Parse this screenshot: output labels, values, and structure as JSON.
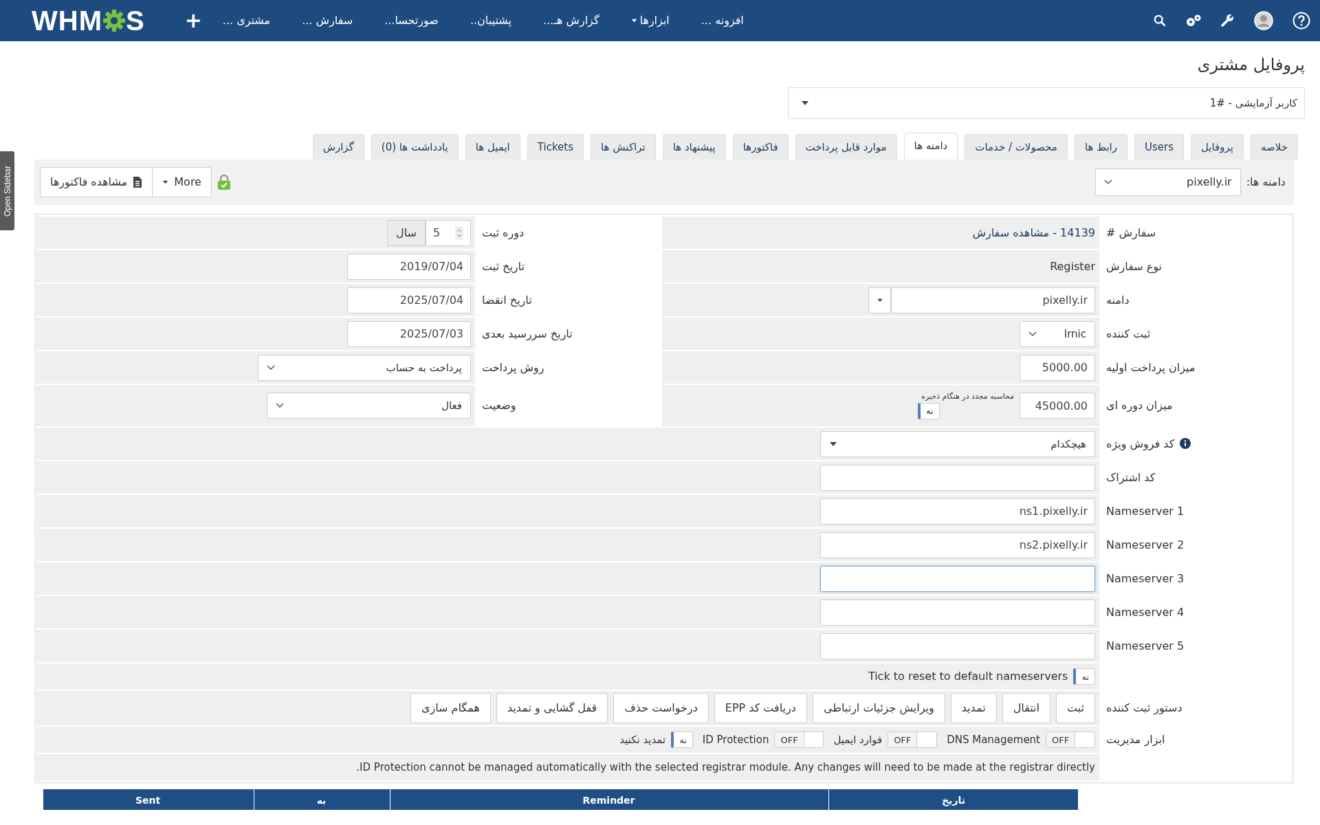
{
  "sidebar_toggle": "Open Sidebar",
  "navbar": {
    "logo": {
      "left": "WHM",
      "right": "S"
    },
    "add": "+",
    "menu": [
      {
        "label": "افزونه ...",
        "dropdown": false
      },
      {
        "label": "ابزارها",
        "dropdown": true
      },
      {
        "label": "گزارش هـ...",
        "dropdown": false
      },
      {
        "label": "پشتیبان..",
        "dropdown": false
      },
      {
        "label": "صورتحسا...",
        "dropdown": false
      },
      {
        "label": "سفارش ...",
        "dropdown": false
      },
      {
        "label": "مشتری ...",
        "dropdown": false
      }
    ]
  },
  "page_title": "پروفایل مشتری",
  "client_select": "کاربر آزمایشی - #1",
  "tabs": [
    {
      "label": "خلاصه",
      "selected": false
    },
    {
      "label": "پروفایل",
      "selected": false
    },
    {
      "label": "Users",
      "selected": false
    },
    {
      "label": "رابط ها",
      "selected": false
    },
    {
      "label": "محصولات / خدمات",
      "selected": false
    },
    {
      "label": "دامنه ها",
      "selected": true
    },
    {
      "label": "موارد قابل پرداخت",
      "selected": false
    },
    {
      "label": "فاکتورها",
      "selected": false
    },
    {
      "label": "پیشنهاد ها",
      "selected": false
    },
    {
      "label": "تراکنش ها",
      "selected": false
    },
    {
      "label": "Tickets",
      "selected": false
    },
    {
      "label": "ایمیل ها",
      "selected": false
    },
    {
      "label": "یادداشت ها (0)",
      "selected": false
    },
    {
      "label": "گزارش",
      "selected": false
    }
  ],
  "toolbar": {
    "domain_label": "دامنه ها:",
    "domain_value": "pixelly.ir",
    "more": "More",
    "view_invoices": "مشاهده فاکتورها"
  },
  "form": {
    "rows": [
      {
        "label": "سفارش #",
        "field": {
          "kind": "link",
          "value": "14139 - مشاهده سفارش"
        },
        "side": {
          "label": "دوره ثبت",
          "field": {
            "kind": "years",
            "value": "5",
            "unit": "سال"
          }
        }
      },
      {
        "label": "نوع سفارش",
        "field": {
          "kind": "text",
          "value": "Register"
        },
        "side": {
          "label": "تاریخ ثبت",
          "field": {
            "kind": "date",
            "value": "2019/07/04"
          }
        }
      },
      {
        "label": "دامنه",
        "field": {
          "kind": "input-dropdown",
          "value": "pixelly.ir"
        },
        "side": {
          "label": "تاریخ انقضا",
          "field": {
            "kind": "date",
            "value": "2025/07/04"
          }
        }
      },
      {
        "label": "ثبت کننده",
        "field": {
          "kind": "select-short",
          "value": "Irnic"
        },
        "side": {
          "label": "تاریخ سررسید بعدی",
          "field": {
            "kind": "date",
            "value": "2025/07/03"
          }
        }
      },
      {
        "label": "میزان پرداخت اولیه",
        "field": {
          "kind": "input-short",
          "value": "5000.00"
        },
        "side": {
          "label": "روش پرداخت",
          "field": {
            "kind": "select-long",
            "value": "پرداخت به حساب"
          }
        }
      },
      {
        "label": "میزان دوره ای",
        "field": {
          "kind": "amount-recalc",
          "value": "45000.00",
          "note": "محاسبه مجدد در هنگام ذخیره",
          "toggle": {
            "label": "نه",
            "on": false
          }
        },
        "side": {
          "label": "وضعیت",
          "field": {
            "kind": "select-medium",
            "value": "فعال"
          }
        }
      },
      {
        "label": "کد فروش ویژه",
        "field": {
          "kind": "promo-select",
          "value": "هیچکدام"
        }
      },
      {
        "label": "کد اشتراک",
        "field": {
          "kind": "input",
          "focused": false
        }
      },
      {
        "label": "Nameserver 1",
        "field": {
          "kind": "input",
          "value": "ns1.pixelly.ir",
          "focused": false
        }
      },
      {
        "label": "Nameserver 2",
        "field": {
          "kind": "input",
          "value": "ns2.pixelly.ir",
          "focused": false
        }
      },
      {
        "label": "Nameserver 3",
        "field": {
          "kind": "input",
          "focused": true
        }
      },
      {
        "label": "Nameserver 4",
        "field": {
          "kind": "input",
          "focused": false
        }
      },
      {
        "label": "Nameserver 5",
        "field": {
          "kind": "input",
          "focused": false
        }
      },
      {
        "field": {
          "kind": "toggle-note",
          "toggle": {
            "label": "نه",
            "on": false
          },
          "text": "Tick to reset to default nameservers"
        }
      },
      {
        "label": "دستور ثبت کننده",
        "field": {
          "kind": "buttons",
          "buttons": [
            "ثبت",
            "انتقال",
            "تمدید",
            "ویرایش جزئیات ارتباطی",
            "دریافت کد EPP",
            "درخواست حذف",
            "قفل گشایی و تمدید",
            "همگام سازی"
          ]
        }
      },
      {
        "label": "ابزار مدیریت",
        "field": {
          "kind": "switches",
          "items": [
            {
              "label": "DNS Management",
              "kind": "box",
              "switch": "OFF",
              "on": false
            },
            {
              "label": "فوارد ایمیل",
              "kind": "box",
              "switch": "OFF",
              "on": false
            },
            {
              "label": "ID Protection",
              "kind": "box",
              "switch": "OFF",
              "on": false
            },
            {
              "label": "تمدید نکنید",
              "kind": "bar",
              "switch": "نه",
              "on": false
            }
          ]
        }
      },
      {
        "field": {
          "kind": "note",
          "text": "ID Protection cannot be managed automatically with the selected registrar module. Any changes will need to be made at the registrar directly."
        }
      }
    ]
  },
  "reminders_table": {
    "columns": [
      "تاریخ",
      "Reminder",
      "به",
      "Sent"
    ]
  }
}
